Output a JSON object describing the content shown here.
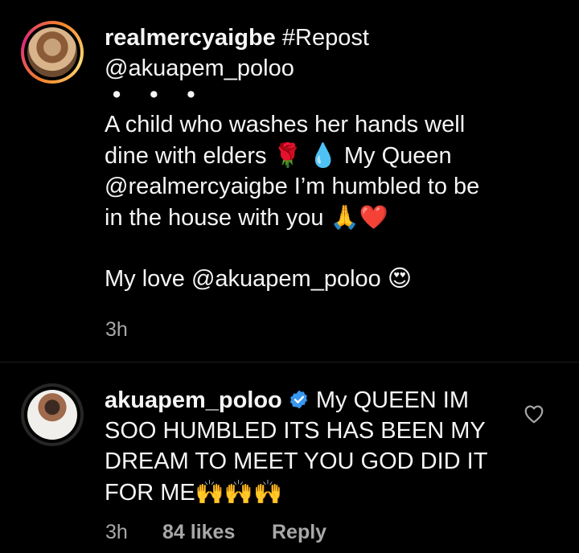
{
  "comment1": {
    "avatar_icon": "profile-photo-realmercyaigbe",
    "username": "realmercyaigbe",
    "hashtag": "#Repost",
    "mention": "@akuapem_poloo",
    "dots": "• • •",
    "line1": "A child who washes her hands well",
    "line2_pre": "dine with elders ",
    "line2_emoji1": "🌹",
    "line2_emoji2": "💧",
    "line2_post": " My Queen",
    "line3": "@realmercyaigbe I’m humbled to be",
    "line4_pre": "in the house with you ",
    "line4_emoji": "🙏❤️",
    "line5_pre": "My love @akuapem_poloo ",
    "line5_emoji": "😍",
    "time": "3h"
  },
  "comment2": {
    "avatar_icon": "profile-photo-akuapem_poloo",
    "username": "akuapem_poloo",
    "verified_icon": "verified-badge-icon",
    "text1": " My QUEEN IM",
    "text2": "SOO HUMBLED ITS HAS BEEN MY",
    "text3": "DREAM TO MEET YOU GOD DID IT",
    "text4_pre": "FOR ME",
    "text4_emoji": "🙌🙌🙌",
    "time": "3h",
    "likes": "84 likes",
    "reply": "Reply",
    "like_icon": "heart-outline-icon"
  },
  "colors": {
    "background": "#000000",
    "text": "#f5f5f5",
    "meta": "#a8a8a8",
    "verified": "#3897f0"
  }
}
